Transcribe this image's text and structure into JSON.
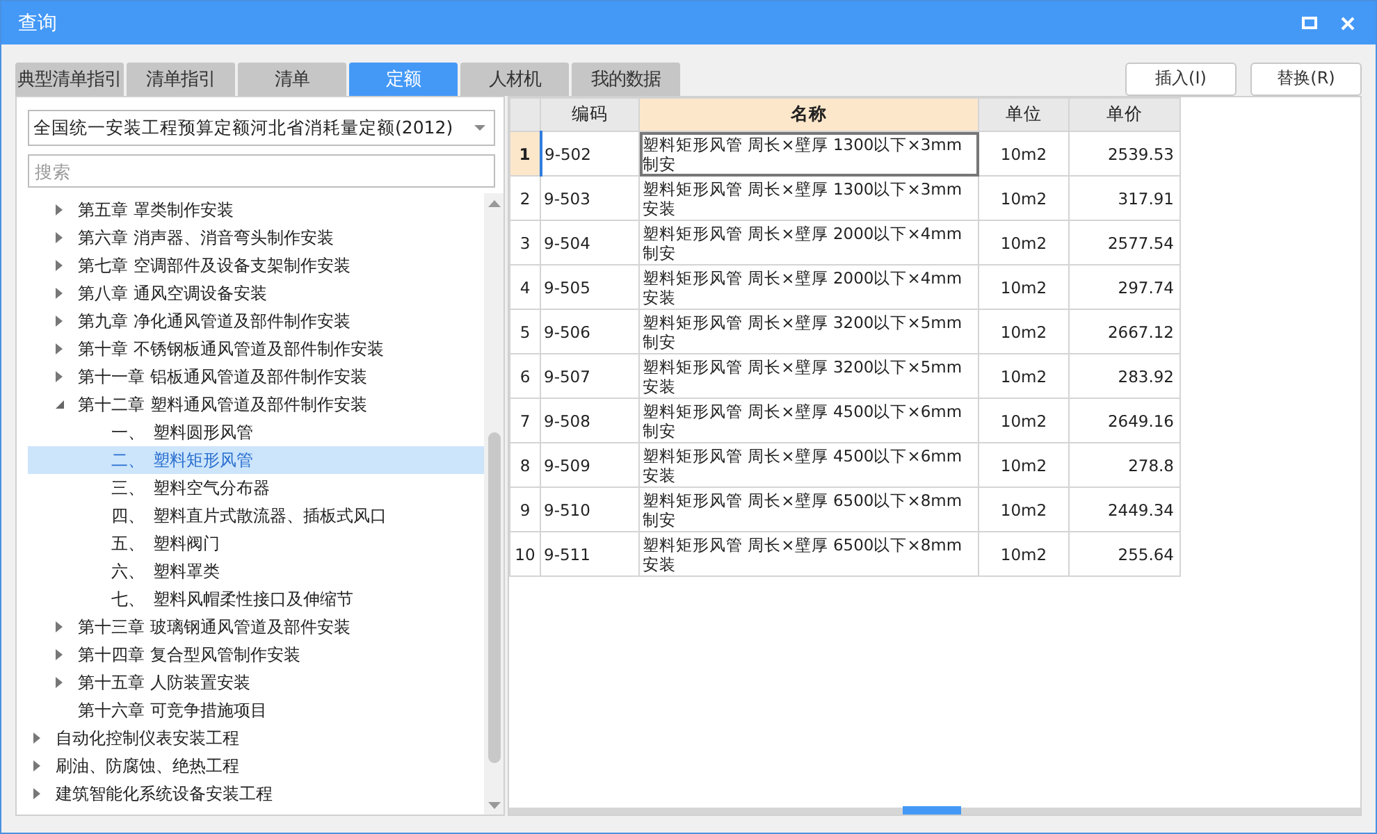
{
  "window": {
    "title": "查询"
  },
  "tabs": [
    {
      "label": "典型清单指引",
      "selected": false
    },
    {
      "label": "清单指引",
      "selected": false
    },
    {
      "label": "清单",
      "selected": false
    },
    {
      "label": "定额",
      "selected": true
    },
    {
      "label": "人材机",
      "selected": false
    },
    {
      "label": "我的数据",
      "selected": false
    }
  ],
  "buttons": [
    "插入(I)",
    "替换(R)"
  ],
  "quota_select": {
    "value": "全国统一安装工程预算定额河北省消耗量定额(2012)"
  },
  "search": {
    "placeholder": "搜索"
  },
  "tree": [
    {
      "children": [
        {
          "label": "第五章 罩类制作安装",
          "expanded": false,
          "selected": false
        },
        {
          "label": "第六章 消声器、消音弯头制作安装",
          "expanded": false,
          "selected": false
        },
        {
          "label": "第七章 空调部件及设备支架制作安装",
          "expanded": false,
          "selected": false
        },
        {
          "label": "第八章 通风空调设备安装",
          "expanded": false,
          "selected": false
        },
        {
          "label": "第九章 净化通风管道及部件制作安装",
          "expanded": false,
          "selected": false
        },
        {
          "label": "第十章 不锈钢板通风管道及部件制作安装",
          "expanded": false,
          "selected": false
        },
        {
          "label": "第十一章 铝板通风管道及部件制作安装",
          "expanded": false,
          "selected": false
        },
        {
          "label": "第十二章 塑料通风管道及部件制作安装",
          "expanded": true,
          "selected": false,
          "children": [
            {
              "num": "一、",
              "label": "塑料圆形风管",
              "selected": false
            },
            {
              "num": "二、",
              "label": "塑料矩形风管",
              "selected": true
            },
            {
              "num": "三、",
              "label": "塑料空气分布器",
              "selected": false
            },
            {
              "num": "四、",
              "label": "塑料直片式散流器、插板式风口",
              "selected": false
            },
            {
              "num": "五、",
              "label": "塑料阀门",
              "selected": false
            },
            {
              "num": "六、",
              "label": "塑料罩类",
              "selected": false
            },
            {
              "num": "七、",
              "label": "塑料风帽柔性接口及伸缩节",
              "selected": false
            }
          ]
        },
        {
          "label": "第十三章 玻璃钢通风管道及部件安装",
          "expanded": false,
          "selected": false
        },
        {
          "label": "第十四章 复合型风管制作安装",
          "expanded": false,
          "selected": false
        },
        {
          "label": "第十五章 人防装置安装",
          "expanded": false,
          "selected": false
        },
        {
          "label": "第十六章 可竞争措施项目",
          "selected": false
        }
      ]
    },
    {
      "label": "自动化控制仪表安装工程",
      "expanded": false,
      "selected": false
    },
    {
      "label": "刷油、防腐蚀、绝热工程",
      "expanded": false,
      "selected": false
    },
    {
      "label": "建筑智能化系统设备安装工程",
      "expanded": false,
      "selected": false
    }
  ],
  "table": {
    "columns": [
      {
        "label": "编码",
        "selected": false
      },
      {
        "label": "名称",
        "selected": true
      },
      {
        "label": "单位",
        "selected": false
      },
      {
        "label": "单价",
        "selected": false
      }
    ],
    "rows": [
      {
        "index": "1",
        "code": "9-502",
        "name": "塑料矩形风管 周长×壁厚 1300以下×3mm 制安",
        "unit": "10m2",
        "price": "2539.53",
        "selected": true
      },
      {
        "index": "2",
        "code": "9-503",
        "name": "塑料矩形风管 周长×壁厚 1300以下×3mm 安装",
        "unit": "10m2",
        "price": "317.91",
        "selected": false
      },
      {
        "index": "3",
        "code": "9-504",
        "name": "塑料矩形风管 周长×壁厚 2000以下×4mm 制安",
        "unit": "10m2",
        "price": "2577.54",
        "selected": false
      },
      {
        "index": "4",
        "code": "9-505",
        "name": "塑料矩形风管 周长×壁厚 2000以下×4mm 安装",
        "unit": "10m2",
        "price": "297.74",
        "selected": false
      },
      {
        "index": "5",
        "code": "9-506",
        "name": "塑料矩形风管 周长×壁厚 3200以下×5mm 制安",
        "unit": "10m2",
        "price": "2667.12",
        "selected": false
      },
      {
        "index": "6",
        "code": "9-507",
        "name": "塑料矩形风管 周长×壁厚 3200以下×5mm 安装",
        "unit": "10m2",
        "price": "283.92",
        "selected": false
      },
      {
        "index": "7",
        "code": "9-508",
        "name": "塑料矩形风管 周长×壁厚 4500以下×6mm 制安",
        "unit": "10m2",
        "price": "2649.16",
        "selected": false
      },
      {
        "index": "8",
        "code": "9-509",
        "name": "塑料矩形风管 周长×壁厚 4500以下×6mm 安装",
        "unit": "10m2",
        "price": "278.8",
        "selected": false
      },
      {
        "index": "9",
        "code": "9-510",
        "name": "塑料矩形风管 周长×壁厚 6500以下×8mm 制安",
        "unit": "10m2",
        "price": "2449.34",
        "selected": false
      },
      {
        "index": "10",
        "code": "9-511",
        "name": "塑料矩形风管 周长×壁厚 6500以下×8mm 安装",
        "unit": "10m2",
        "price": "255.64",
        "selected": false
      }
    ]
  }
}
